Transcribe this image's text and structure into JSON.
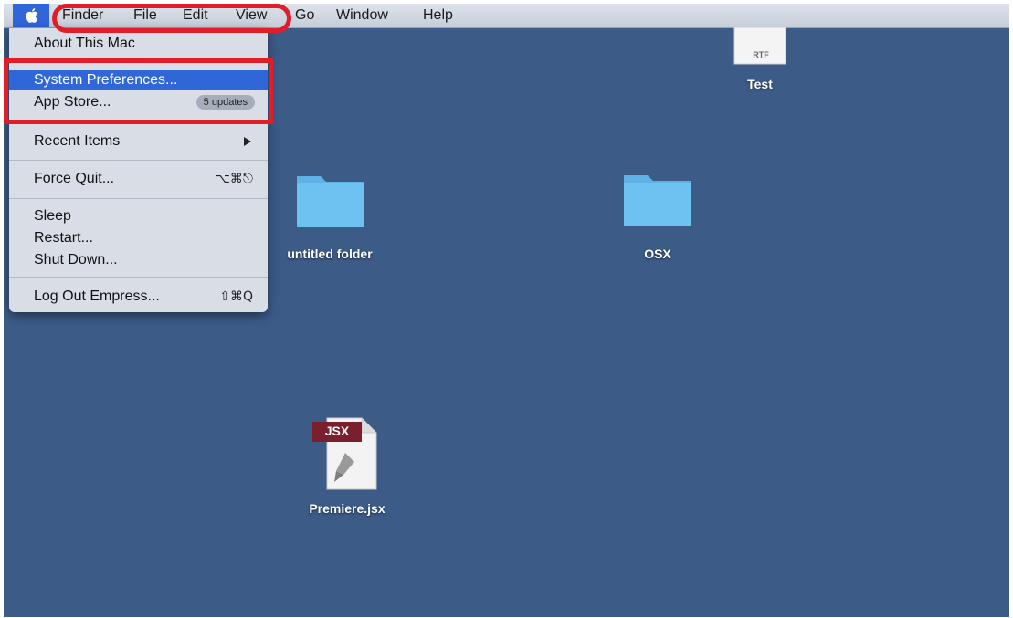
{
  "menubar": {
    "apple_icon": "apple-icon",
    "items": [
      "Finder",
      "File",
      "Edit",
      "View",
      "Go",
      "Window",
      "Help"
    ]
  },
  "apple_menu": {
    "about": "About This Mac",
    "system_prefs": "System Preferences...",
    "app_store": "App Store...",
    "app_store_badge": "5 updates",
    "recent": "Recent Items",
    "force_quit": "Force Quit...",
    "force_quit_shortcut": "⌥⌘⎋",
    "sleep": "Sleep",
    "restart": "Restart...",
    "shut_down": "Shut Down...",
    "log_out": "Log Out Empress...",
    "log_out_shortcut": "⇧⌘Q"
  },
  "desktop": {
    "rtf_file": {
      "name": "Test",
      "type_label": "RTF"
    },
    "folder1": {
      "name": "untitled folder"
    },
    "folder2": {
      "name": "OSX"
    },
    "jsx_file": {
      "name": "Premiere.jsx",
      "type_label": "JSX"
    }
  },
  "colors": {
    "desktop": "#3c5b87",
    "highlight": "#2f67d8",
    "annotation": "#e21d2a",
    "folder": "#6ec2f1"
  }
}
